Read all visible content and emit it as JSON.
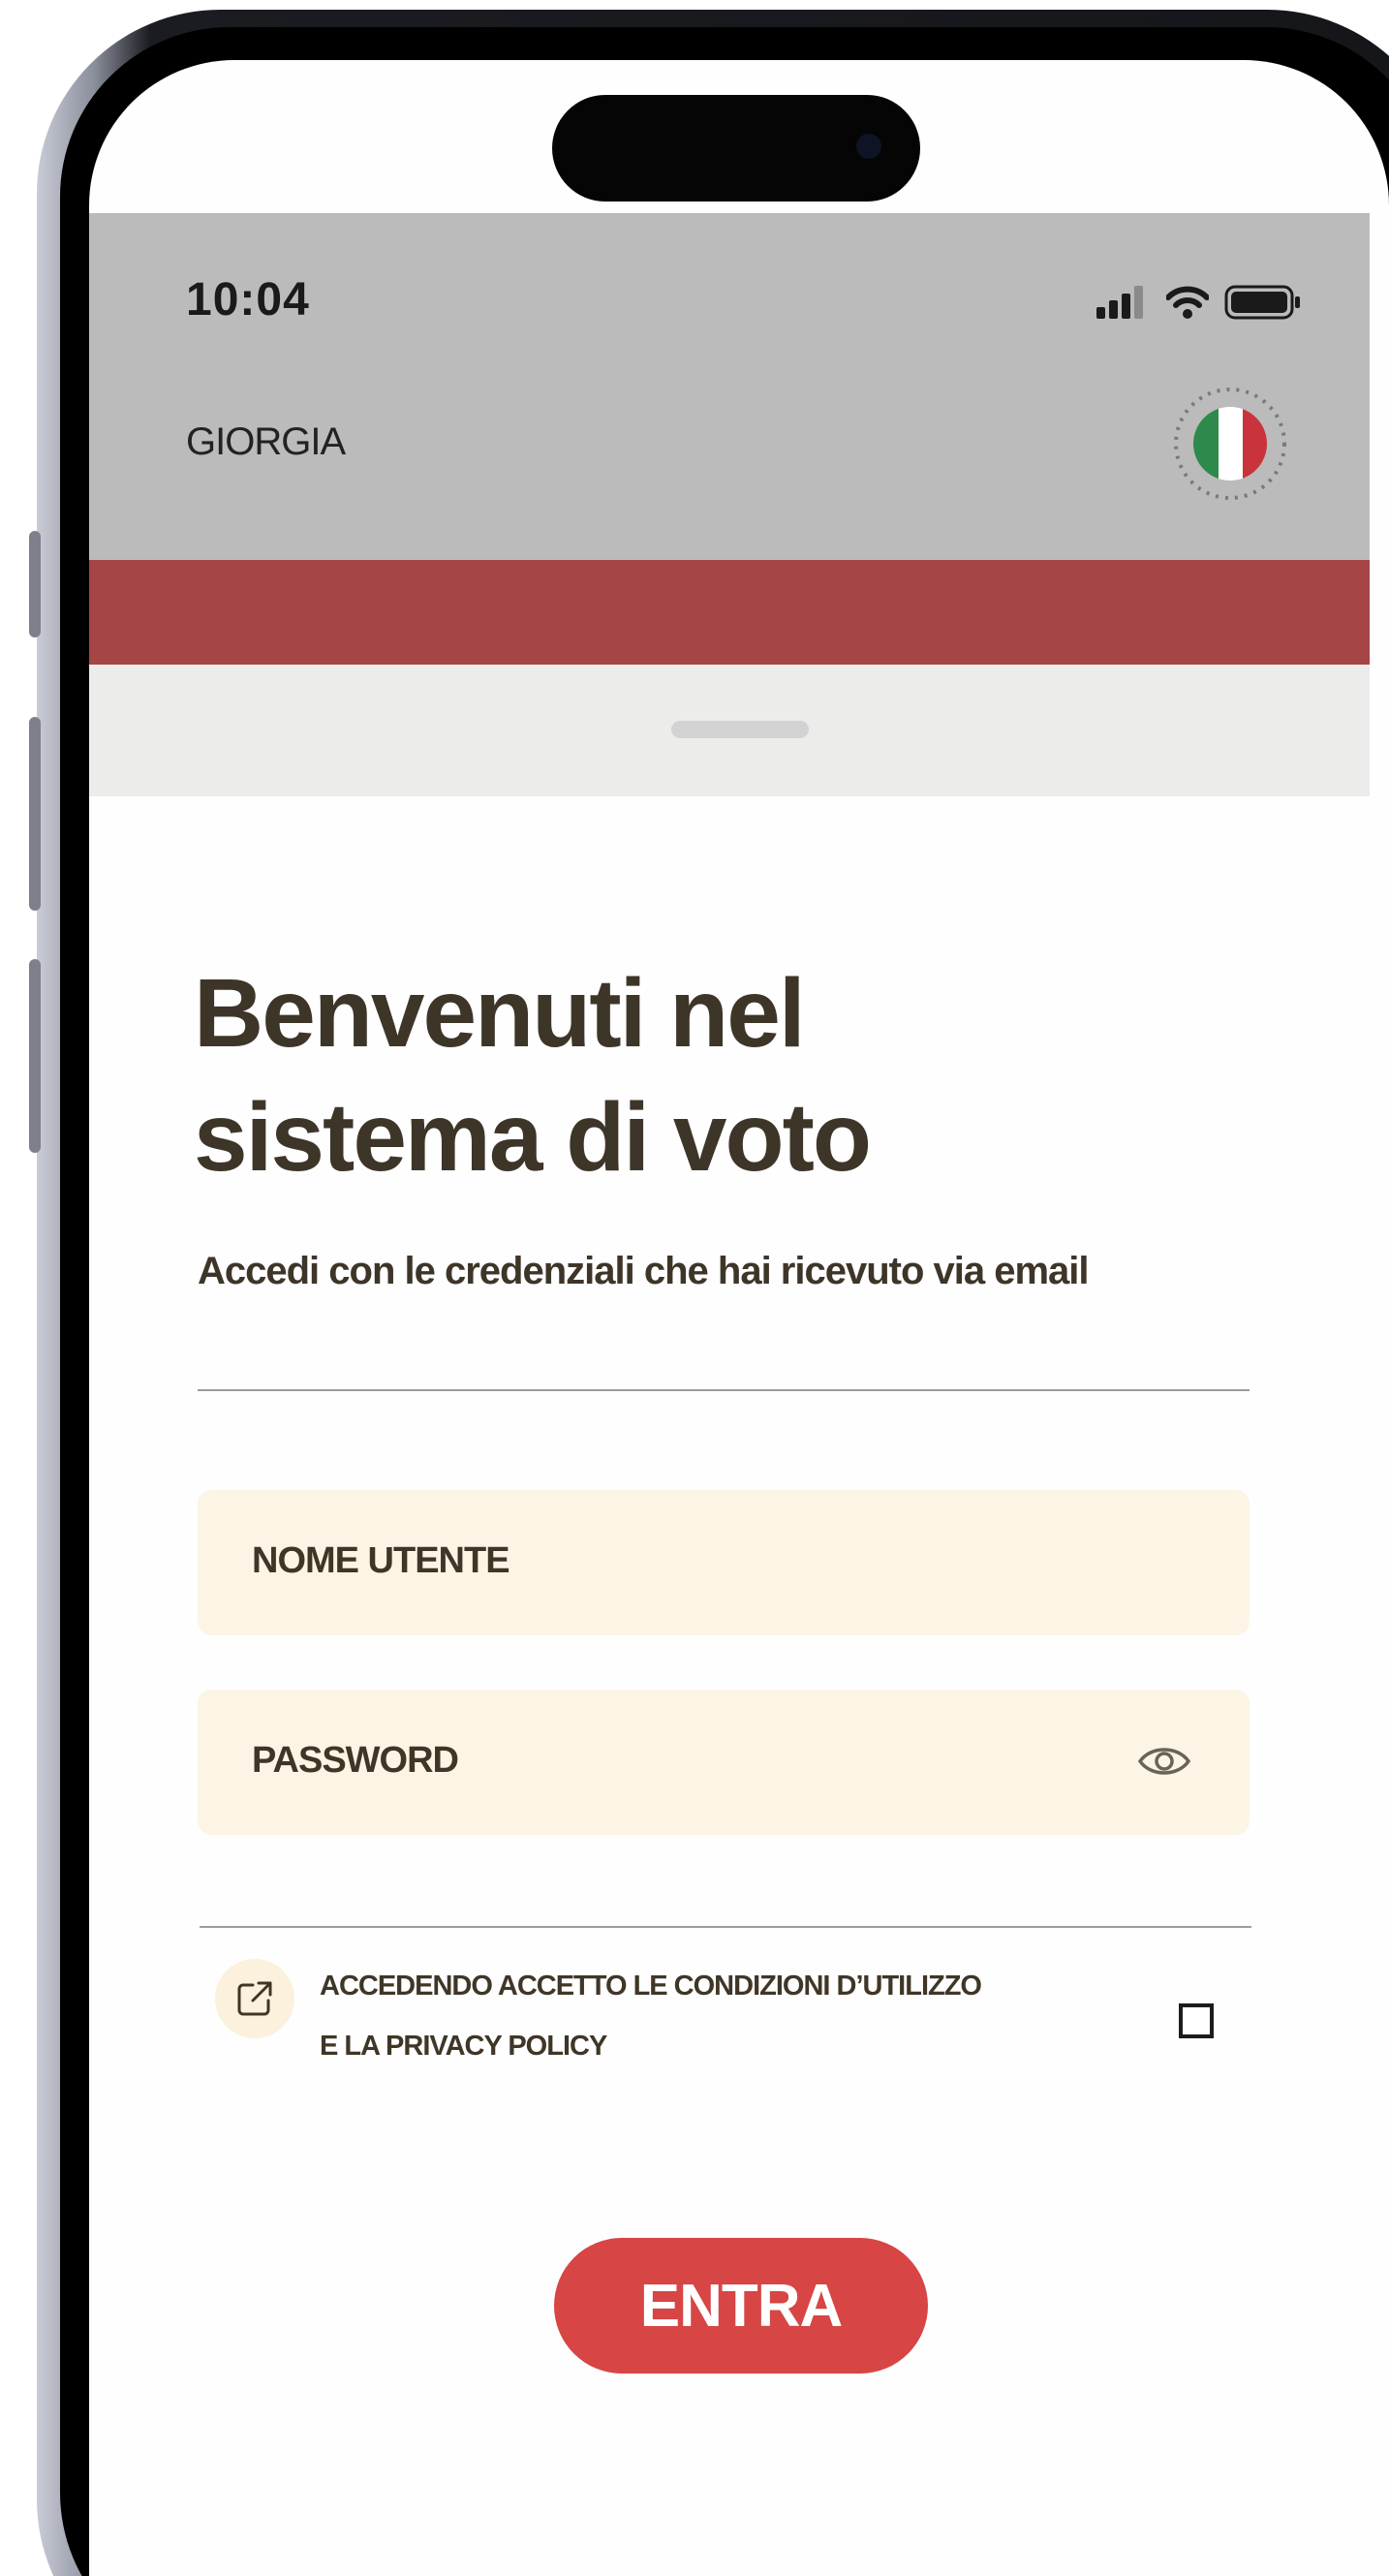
{
  "status_bar": {
    "time": "10:04",
    "icons": [
      "cellular-signal-icon",
      "wifi-icon",
      "battery-icon"
    ]
  },
  "header": {
    "app_name": "GIORGIA",
    "flag_icon": "italian-flag-icon"
  },
  "colors": {
    "header_bg": "#bbbbbb",
    "accent_band": "#a54545",
    "field_bg": "#fcf5e6",
    "primary_button": "#d74545",
    "text_dark": "#3e3529"
  },
  "login": {
    "title": "Benvenuti nel sistema di voto",
    "subtitle": "Accedi con le credenziali che hai ricevuto via email",
    "username_placeholder": "NOME UTENTE",
    "password_placeholder": "PASSWORD",
    "terms_line_1": "ACCEDENDO ACCETTO LE CONDIZIONI D’UTILIZZO",
    "terms_line_2": "E LA PRIVACY POLICY",
    "terms_icon": "external-link-icon",
    "terms_checked": false,
    "submit_label": "ENTRA"
  }
}
